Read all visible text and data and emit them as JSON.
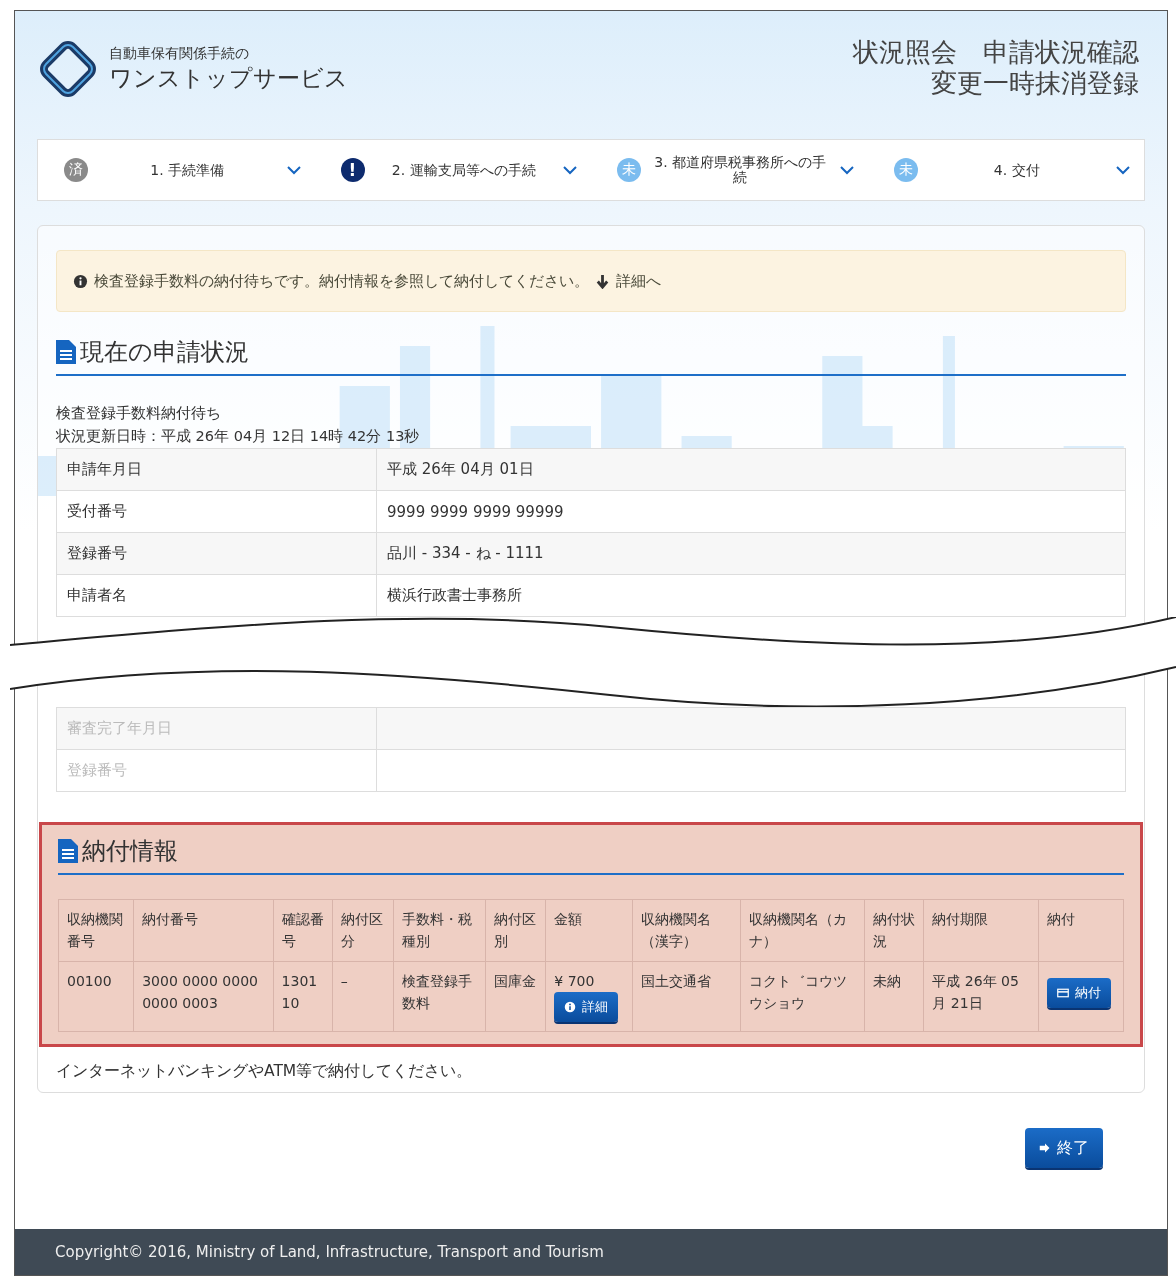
{
  "header": {
    "logo_caption": "自動車保有関係手続の",
    "logo_title": "ワンストップサービス",
    "title_lines": [
      "状況照会　申請状況確認",
      "変更一時抹消登録"
    ]
  },
  "steps": [
    {
      "badge": "済",
      "kind": "done",
      "label": "1. 手続準備"
    },
    {
      "badge": "!",
      "kind": "alert",
      "label": "2. 運輸支局等への手続"
    },
    {
      "badge": "未",
      "kind": "pending",
      "label": "3. 都道府県税事務所への手続"
    },
    {
      "badge": "未",
      "kind": "pending",
      "label": "4. 交付"
    }
  ],
  "alert": {
    "message": "検査登録手数料の納付待ちです。納付情報を参照して納付してください。",
    "link": "詳細へ"
  },
  "status_section": {
    "heading": "現在の申請状況",
    "status": "検査登録手数料納付待ち",
    "updated": "状況更新日時：平成 26年 04月 12日 14時 42分 13秒",
    "rows_before": [
      {
        "label": "申請年月日",
        "value": "平成 26年 04月 01日"
      },
      {
        "label": "受付番号",
        "value": "9999 9999 9999 99999"
      },
      {
        "label": "登録番号",
        "value": "品川 - 334 - ね - 1111"
      },
      {
        "label": "申請者名",
        "value": "横浜行政書士事務所"
      }
    ],
    "rows_after": [
      {
        "label": "審査完了年月日",
        "dimmed": true
      },
      {
        "label": "登録番号",
        "dimmed": true
      }
    ]
  },
  "payment_section": {
    "heading": "納付情報",
    "highlighted": true,
    "columns": [
      "収納機関番号",
      "納付番号",
      "確認番号",
      "納付区分",
      "手数料・税種別",
      "納付区別",
      "金額",
      "収納機関名（漢字）",
      "収納機関名（カナ）",
      "納付状況",
      "納付期限",
      "納付"
    ],
    "rows": [
      [
        {
          "kind": "text",
          "text": "00100"
        },
        {
          "kind": "text",
          "text": "3000 0000 0000 0000 0003"
        },
        {
          "kind": "text",
          "text": "130110"
        },
        {
          "kind": "text",
          "text": "–"
        },
        {
          "kind": "text",
          "text": "検査登録手数料"
        },
        {
          "kind": "text",
          "text": "国庫金"
        },
        {
          "kind": "amount",
          "text": "¥ 700",
          "button": "詳細"
        },
        {
          "kind": "text",
          "text": "国土交通省"
        },
        {
          "kind": "text",
          "text": "コクト゛コウツウショウ"
        },
        {
          "kind": "text",
          "text": "未納"
        },
        {
          "kind": "text",
          "text": "平成 26年 05月 21日"
        },
        {
          "kind": "button",
          "button": "納付"
        }
      ]
    ],
    "note": "インターネットバンキングやATM等で納付してください。"
  },
  "exit_button": "終了",
  "footer": "Copyright© 2016, Ministry of Land, Infrastructure, Transport and Tourism"
}
